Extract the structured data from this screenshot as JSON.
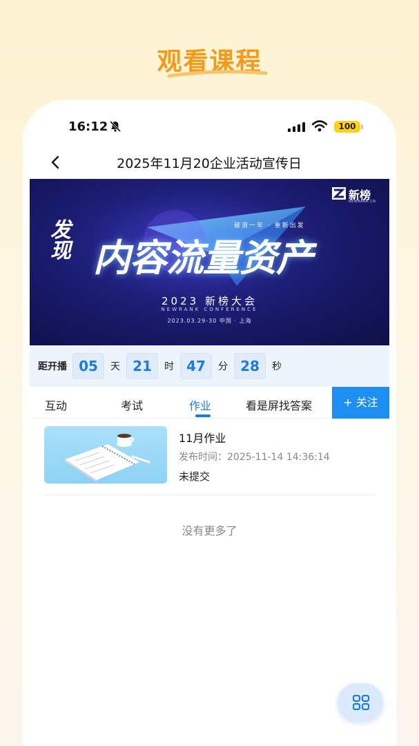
{
  "promo": {
    "title": "观看课程"
  },
  "status_bar": {
    "time": "16:12",
    "battery": "100"
  },
  "nav": {
    "title": "2025年11月20企业活动宣传日"
  },
  "banner": {
    "logo_text": "新榜",
    "logo_sub": "NEWRANK.CN",
    "small_text": "发现",
    "main_text": "内容流量资产",
    "tagline": "破浪一年 · 重新出发",
    "conference": "2023 新榜大会",
    "conference_en": "NEWRANK CONFERENCE",
    "date_place": "2023.03.29-30   中国 · 上海"
  },
  "countdown": {
    "label": "距开播",
    "days": "05",
    "days_unit": "天",
    "hours": "21",
    "hours_unit": "时",
    "minutes": "47",
    "minutes_unit": "分",
    "seconds": "28",
    "seconds_unit": "秒"
  },
  "tabs": [
    {
      "label": "互动"
    },
    {
      "label": "考试"
    },
    {
      "label": "作业"
    },
    {
      "label": "看是屏找答案"
    }
  ],
  "active_tab": "作业",
  "follow_button": "+ 关注",
  "homework": {
    "title": "11月作业",
    "publish_time": "发布时间：2025-11-14 14:36:14",
    "status": "未提交"
  },
  "list_end_text": "没有更多了",
  "icons": {
    "back": "back-arrow-icon",
    "bell": "bell-off-icon",
    "signal": "signal-icon",
    "wifi": "wifi-icon",
    "grid": "grid-menu-icon"
  },
  "colors": {
    "accent": "#1c7ae0",
    "follow_bg": "#1c8ff0",
    "promo_title": "#f39a1b",
    "battery": "#ffd21a"
  }
}
